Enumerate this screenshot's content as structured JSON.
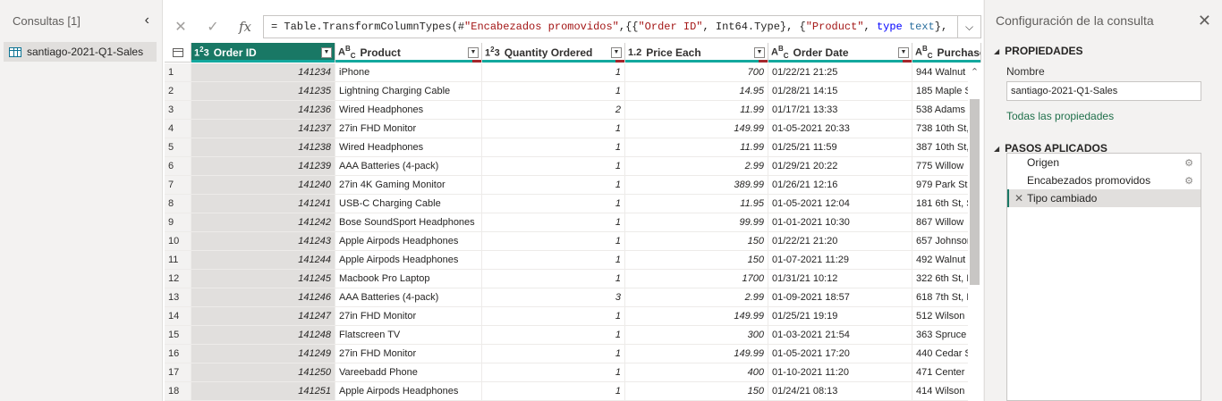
{
  "queries": {
    "title": "Consultas [1]",
    "items": [
      {
        "label": "santiago-2021-Q1-Sales"
      }
    ]
  },
  "formula": {
    "parts": [
      {
        "t": "plain",
        "v": "= Table.TransformColumnTypes(#"
      },
      {
        "t": "s",
        "v": "\"Encabezados promovidos\""
      },
      {
        "t": "plain",
        "v": ",{{"
      },
      {
        "t": "s",
        "v": "\"Order ID\""
      },
      {
        "t": "plain",
        "v": ", Int64.Type}, {"
      },
      {
        "t": "s",
        "v": "\"Product\""
      },
      {
        "t": "plain",
        "v": ", "
      },
      {
        "t": "k",
        "v": "type"
      },
      {
        "t": "plain",
        "v": " "
      },
      {
        "t": "t",
        "v": "text"
      },
      {
        "t": "plain",
        "v": "},"
      }
    ]
  },
  "grid": {
    "columns": [
      {
        "type": "int",
        "label": "Order ID",
        "selected": true
      },
      {
        "type": "text",
        "label": "Product"
      },
      {
        "type": "int",
        "label": "Quantity Ordered"
      },
      {
        "type": "dec",
        "label": "Price Each"
      },
      {
        "type": "text",
        "label": "Order Date"
      },
      {
        "type": "text",
        "label": "Purchase A"
      }
    ],
    "rows": [
      [
        "1",
        "141234",
        "iPhone",
        "1",
        "700",
        "01/22/21 21:25",
        "944 Walnut"
      ],
      [
        "2",
        "141235",
        "Lightning Charging Cable",
        "1",
        "14.95",
        "01/28/21 14:15",
        "185 Maple S"
      ],
      [
        "3",
        "141236",
        "Wired Headphones",
        "2",
        "11.99",
        "01/17/21 13:33",
        "538 Adams"
      ],
      [
        "4",
        "141237",
        "27in FHD Monitor",
        "1",
        "149.99",
        "01-05-2021 20:33",
        "738 10th St,"
      ],
      [
        "5",
        "141238",
        "Wired Headphones",
        "1",
        "11.99",
        "01/25/21 11:59",
        "387 10th St,"
      ],
      [
        "6",
        "141239",
        "AAA Batteries (4-pack)",
        "1",
        "2.99",
        "01/29/21 20:22",
        "775 Willow"
      ],
      [
        "7",
        "141240",
        "27in 4K Gaming Monitor",
        "1",
        "389.99",
        "01/26/21 12:16",
        "979 Park St,"
      ],
      [
        "8",
        "141241",
        "USB-C Charging Cable",
        "1",
        "11.95",
        "01-05-2021 12:04",
        "181 6th St, S"
      ],
      [
        "9",
        "141242",
        "Bose SoundSport Headphones",
        "1",
        "99.99",
        "01-01-2021 10:30",
        "867 Willow"
      ],
      [
        "10",
        "141243",
        "Apple Airpods Headphones",
        "1",
        "150",
        "01/22/21 21:20",
        "657 Johnson"
      ],
      [
        "11",
        "141244",
        "Apple Airpods Headphones",
        "1",
        "150",
        "01-07-2021 11:29",
        "492 Walnut"
      ],
      [
        "12",
        "141245",
        "Macbook Pro Laptop",
        "1",
        "1700",
        "01/31/21 10:12",
        "322 6th St, I"
      ],
      [
        "13",
        "141246",
        "AAA Batteries (4-pack)",
        "3",
        "2.99",
        "01-09-2021 18:57",
        "618 7th St, I"
      ],
      [
        "14",
        "141247",
        "27in FHD Monitor",
        "1",
        "149.99",
        "01/25/21 19:19",
        "512 Wilson"
      ],
      [
        "15",
        "141248",
        "Flatscreen TV",
        "1",
        "300",
        "01-03-2021 21:54",
        "363 Spruce"
      ],
      [
        "16",
        "141249",
        "27in FHD Monitor",
        "1",
        "149.99",
        "01-05-2021 17:20",
        "440 Cedar S"
      ],
      [
        "17",
        "141250",
        "Vareebadd Phone",
        "1",
        "400",
        "01-10-2021 11:20",
        "471 Center"
      ],
      [
        "18",
        "141251",
        "Apple Airpods Headphones",
        "1",
        "150",
        "01/24/21 08:13",
        "414 Wilson"
      ]
    ]
  },
  "settings": {
    "title": "Configuración de la consulta",
    "properties_title": "PROPIEDADES",
    "name_label": "Nombre",
    "name_value": "santiago-2021-Q1-Sales",
    "all_properties": "Todas las propiedades",
    "steps_title": "PASOS APLICADOS",
    "steps": [
      {
        "label": "Origen",
        "gear": true
      },
      {
        "label": "Encabezados promovidos",
        "gear": true
      },
      {
        "label": "Tipo cambiado",
        "active": true
      }
    ]
  },
  "colors": {
    "accent": "#197865",
    "quality_bar": "#13a89e",
    "link": "#1f6f4a"
  },
  "icons": [
    "chevron-left-icon",
    "table-icon",
    "cancel-icon",
    "check-icon",
    "fx-icon",
    "chevron-down-icon",
    "close-icon",
    "gear-icon",
    "delete-step-icon"
  ]
}
